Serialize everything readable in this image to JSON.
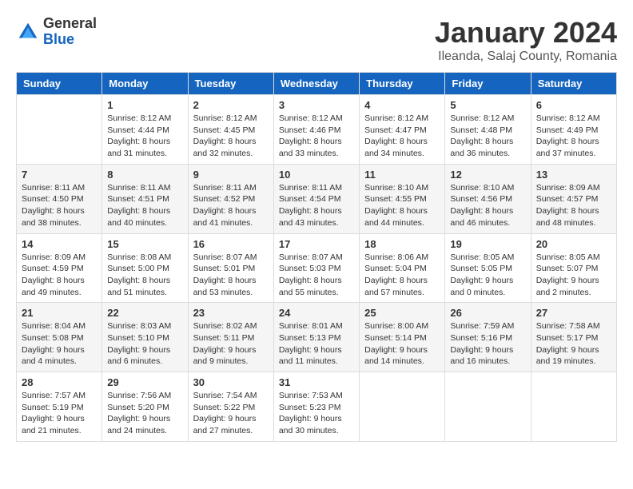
{
  "header": {
    "logo": {
      "general": "General",
      "blue": "Blue"
    },
    "title": "January 2024",
    "location": "Ileanda, Salaj County, Romania"
  },
  "weekdays": [
    "Sunday",
    "Monday",
    "Tuesday",
    "Wednesday",
    "Thursday",
    "Friday",
    "Saturday"
  ],
  "weeks": [
    [
      {
        "day": "",
        "sunrise": "",
        "sunset": "",
        "daylight": ""
      },
      {
        "day": "1",
        "sunrise": "Sunrise: 8:12 AM",
        "sunset": "Sunset: 4:44 PM",
        "daylight": "Daylight: 8 hours and 31 minutes."
      },
      {
        "day": "2",
        "sunrise": "Sunrise: 8:12 AM",
        "sunset": "Sunset: 4:45 PM",
        "daylight": "Daylight: 8 hours and 32 minutes."
      },
      {
        "day": "3",
        "sunrise": "Sunrise: 8:12 AM",
        "sunset": "Sunset: 4:46 PM",
        "daylight": "Daylight: 8 hours and 33 minutes."
      },
      {
        "day": "4",
        "sunrise": "Sunrise: 8:12 AM",
        "sunset": "Sunset: 4:47 PM",
        "daylight": "Daylight: 8 hours and 34 minutes."
      },
      {
        "day": "5",
        "sunrise": "Sunrise: 8:12 AM",
        "sunset": "Sunset: 4:48 PM",
        "daylight": "Daylight: 8 hours and 36 minutes."
      },
      {
        "day": "6",
        "sunrise": "Sunrise: 8:12 AM",
        "sunset": "Sunset: 4:49 PM",
        "daylight": "Daylight: 8 hours and 37 minutes."
      }
    ],
    [
      {
        "day": "7",
        "sunrise": "Sunrise: 8:11 AM",
        "sunset": "Sunset: 4:50 PM",
        "daylight": "Daylight: 8 hours and 38 minutes."
      },
      {
        "day": "8",
        "sunrise": "Sunrise: 8:11 AM",
        "sunset": "Sunset: 4:51 PM",
        "daylight": "Daylight: 8 hours and 40 minutes."
      },
      {
        "day": "9",
        "sunrise": "Sunrise: 8:11 AM",
        "sunset": "Sunset: 4:52 PM",
        "daylight": "Daylight: 8 hours and 41 minutes."
      },
      {
        "day": "10",
        "sunrise": "Sunrise: 8:11 AM",
        "sunset": "Sunset: 4:54 PM",
        "daylight": "Daylight: 8 hours and 43 minutes."
      },
      {
        "day": "11",
        "sunrise": "Sunrise: 8:10 AM",
        "sunset": "Sunset: 4:55 PM",
        "daylight": "Daylight: 8 hours and 44 minutes."
      },
      {
        "day": "12",
        "sunrise": "Sunrise: 8:10 AM",
        "sunset": "Sunset: 4:56 PM",
        "daylight": "Daylight: 8 hours and 46 minutes."
      },
      {
        "day": "13",
        "sunrise": "Sunrise: 8:09 AM",
        "sunset": "Sunset: 4:57 PM",
        "daylight": "Daylight: 8 hours and 48 minutes."
      }
    ],
    [
      {
        "day": "14",
        "sunrise": "Sunrise: 8:09 AM",
        "sunset": "Sunset: 4:59 PM",
        "daylight": "Daylight: 8 hours and 49 minutes."
      },
      {
        "day": "15",
        "sunrise": "Sunrise: 8:08 AM",
        "sunset": "Sunset: 5:00 PM",
        "daylight": "Daylight: 8 hours and 51 minutes."
      },
      {
        "day": "16",
        "sunrise": "Sunrise: 8:07 AM",
        "sunset": "Sunset: 5:01 PM",
        "daylight": "Daylight: 8 hours and 53 minutes."
      },
      {
        "day": "17",
        "sunrise": "Sunrise: 8:07 AM",
        "sunset": "Sunset: 5:03 PM",
        "daylight": "Daylight: 8 hours and 55 minutes."
      },
      {
        "day": "18",
        "sunrise": "Sunrise: 8:06 AM",
        "sunset": "Sunset: 5:04 PM",
        "daylight": "Daylight: 8 hours and 57 minutes."
      },
      {
        "day": "19",
        "sunrise": "Sunrise: 8:05 AM",
        "sunset": "Sunset: 5:05 PM",
        "daylight": "Daylight: 9 hours and 0 minutes."
      },
      {
        "day": "20",
        "sunrise": "Sunrise: 8:05 AM",
        "sunset": "Sunset: 5:07 PM",
        "daylight": "Daylight: 9 hours and 2 minutes."
      }
    ],
    [
      {
        "day": "21",
        "sunrise": "Sunrise: 8:04 AM",
        "sunset": "Sunset: 5:08 PM",
        "daylight": "Daylight: 9 hours and 4 minutes."
      },
      {
        "day": "22",
        "sunrise": "Sunrise: 8:03 AM",
        "sunset": "Sunset: 5:10 PM",
        "daylight": "Daylight: 9 hours and 6 minutes."
      },
      {
        "day": "23",
        "sunrise": "Sunrise: 8:02 AM",
        "sunset": "Sunset: 5:11 PM",
        "daylight": "Daylight: 9 hours and 9 minutes."
      },
      {
        "day": "24",
        "sunrise": "Sunrise: 8:01 AM",
        "sunset": "Sunset: 5:13 PM",
        "daylight": "Daylight: 9 hours and 11 minutes."
      },
      {
        "day": "25",
        "sunrise": "Sunrise: 8:00 AM",
        "sunset": "Sunset: 5:14 PM",
        "daylight": "Daylight: 9 hours and 14 minutes."
      },
      {
        "day": "26",
        "sunrise": "Sunrise: 7:59 AM",
        "sunset": "Sunset: 5:16 PM",
        "daylight": "Daylight: 9 hours and 16 minutes."
      },
      {
        "day": "27",
        "sunrise": "Sunrise: 7:58 AM",
        "sunset": "Sunset: 5:17 PM",
        "daylight": "Daylight: 9 hours and 19 minutes."
      }
    ],
    [
      {
        "day": "28",
        "sunrise": "Sunrise: 7:57 AM",
        "sunset": "Sunset: 5:19 PM",
        "daylight": "Daylight: 9 hours and 21 minutes."
      },
      {
        "day": "29",
        "sunrise": "Sunrise: 7:56 AM",
        "sunset": "Sunset: 5:20 PM",
        "daylight": "Daylight: 9 hours and 24 minutes."
      },
      {
        "day": "30",
        "sunrise": "Sunrise: 7:54 AM",
        "sunset": "Sunset: 5:22 PM",
        "daylight": "Daylight: 9 hours and 27 minutes."
      },
      {
        "day": "31",
        "sunrise": "Sunrise: 7:53 AM",
        "sunset": "Sunset: 5:23 PM",
        "daylight": "Daylight: 9 hours and 30 minutes."
      },
      {
        "day": "",
        "sunrise": "",
        "sunset": "",
        "daylight": ""
      },
      {
        "day": "",
        "sunrise": "",
        "sunset": "",
        "daylight": ""
      },
      {
        "day": "",
        "sunrise": "",
        "sunset": "",
        "daylight": ""
      }
    ]
  ]
}
